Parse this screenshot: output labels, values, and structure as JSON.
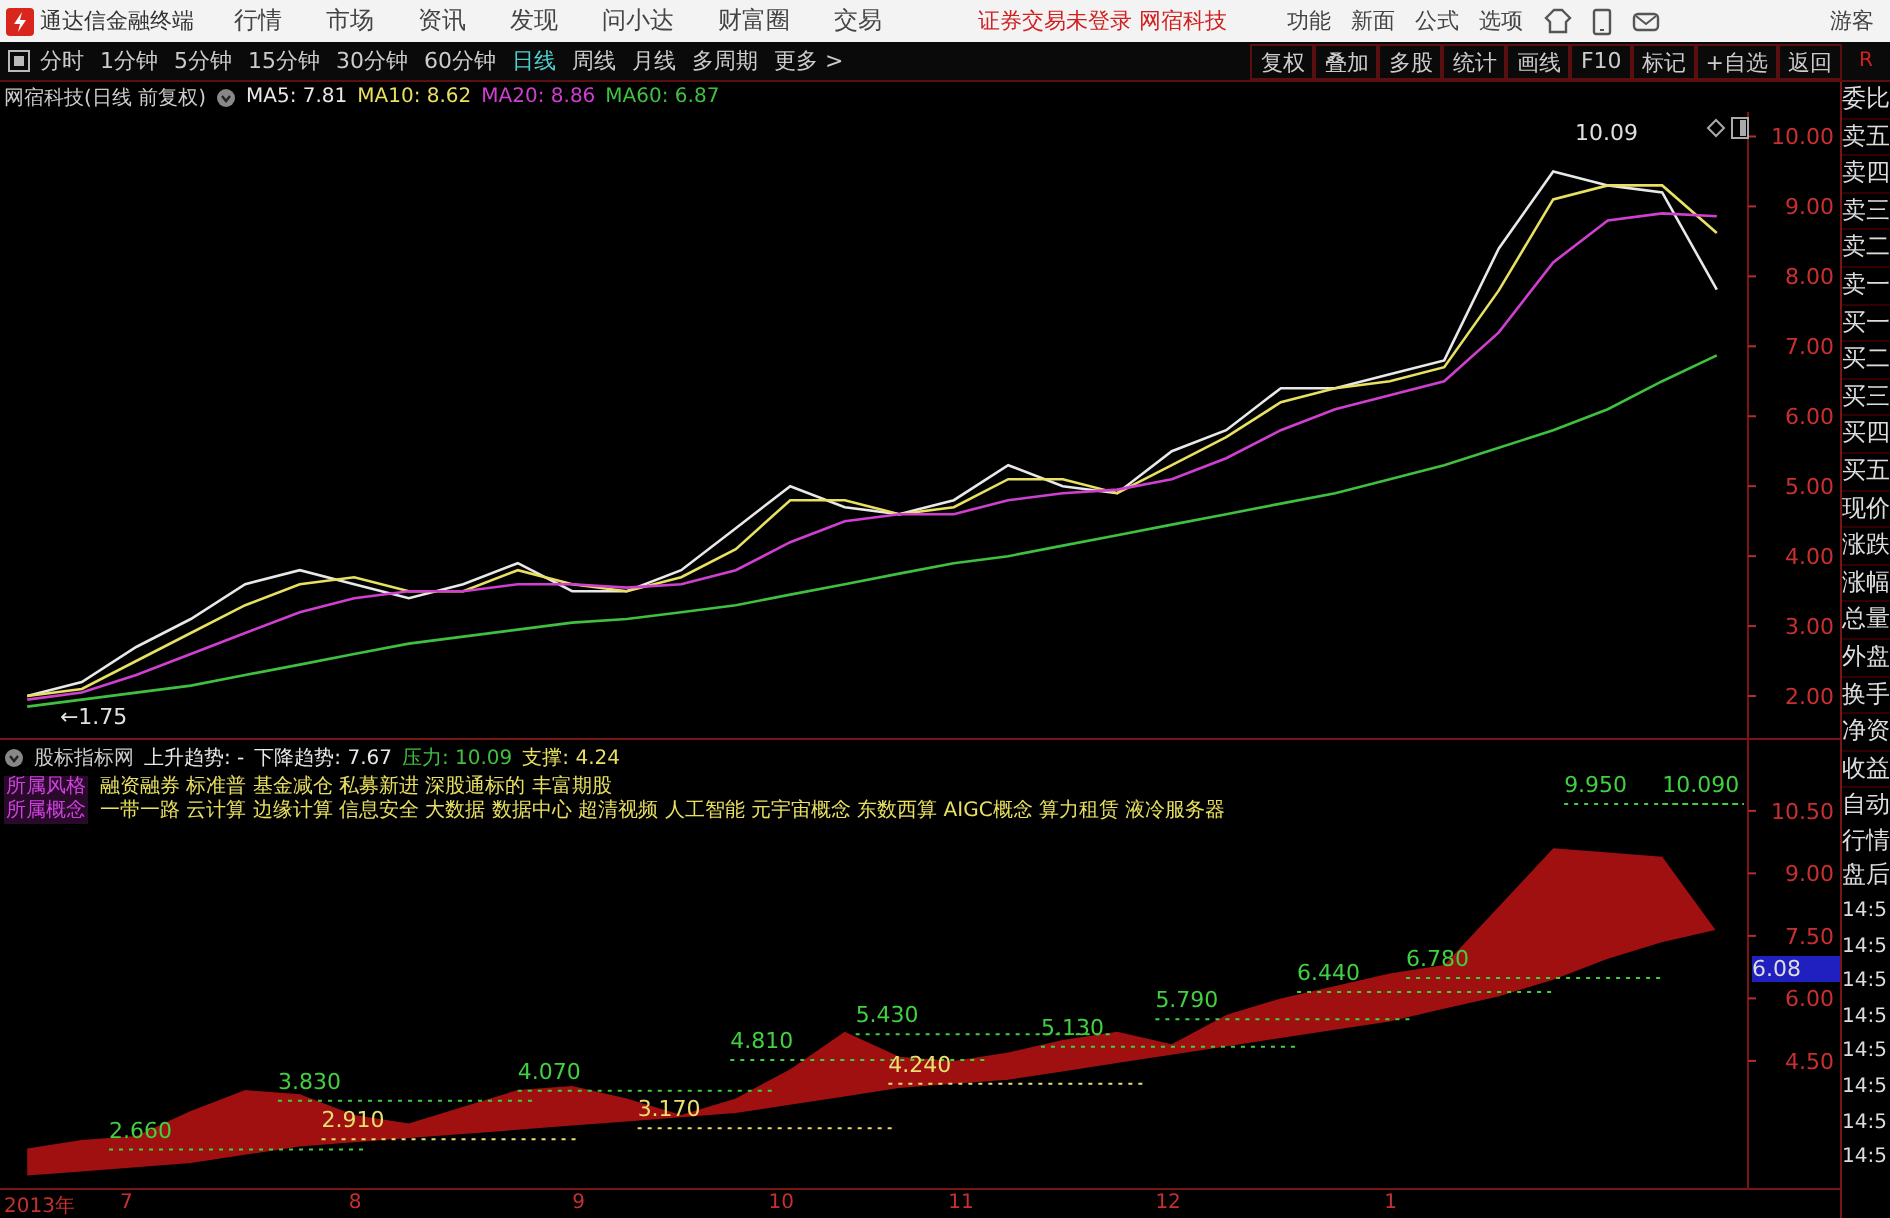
{
  "app": {
    "title": "通达信金融终端",
    "menus": [
      "行情",
      "市场",
      "资讯",
      "发现",
      "问小达",
      "财富圈",
      "交易"
    ],
    "notice": "证券交易未登录 网宿科技",
    "tools": [
      "功能",
      "新面",
      "公式",
      "选项"
    ],
    "user": "游客"
  },
  "toolbar": {
    "periods": [
      {
        "label": "分时",
        "selected": false
      },
      {
        "label": "1分钟",
        "selected": false
      },
      {
        "label": "5分钟",
        "selected": false
      },
      {
        "label": "15分钟",
        "selected": false
      },
      {
        "label": "30分钟",
        "selected": false
      },
      {
        "label": "60分钟",
        "selected": false
      },
      {
        "label": "日线",
        "selected": true
      },
      {
        "label": "周线",
        "selected": false
      },
      {
        "label": "月线",
        "selected": false
      },
      {
        "label": "多周期",
        "selected": false
      },
      {
        "label": "更多 >",
        "selected": false
      }
    ],
    "actions": [
      "复权",
      "叠加",
      "多股",
      "统计",
      "画线",
      "F10",
      "标记",
      "+自选",
      "返回"
    ],
    "corner": "R"
  },
  "price_chart": {
    "title": "网宿科技(日线 前复权)",
    "indicators": [
      {
        "label": "MA5: 7.81",
        "color": "#e8e8e8"
      },
      {
        "label": "MA10: 8.62",
        "color": "#e8e060"
      },
      {
        "label": "MA20: 8.86",
        "color": "#d040d0"
      },
      {
        "label": "MA60: 6.87",
        "color": "#40c040"
      }
    ],
    "chart_data": {
      "type": "line",
      "ylim": [
        1.4,
        10.35
      ],
      "yticks": [
        {
          "value": 2,
          "label": "2.00"
        },
        {
          "value": 3,
          "label": "3.00"
        },
        {
          "value": 4,
          "label": "4.00"
        },
        {
          "value": 5,
          "label": "5.00"
        },
        {
          "value": 6,
          "label": "6.00"
        },
        {
          "value": 7,
          "label": "7.00"
        },
        {
          "value": 8,
          "label": "8.00"
        },
        {
          "value": 9,
          "label": "9.00"
        },
        {
          "value": 10,
          "label": "10.00"
        }
      ],
      "series": [
        {
          "color": "#e8e8e8",
          "values": [
            2.0,
            2.2,
            2.7,
            3.1,
            3.6,
            3.8,
            3.6,
            3.4,
            3.6,
            3.9,
            3.5,
            3.5,
            3.8,
            4.4,
            5.0,
            4.7,
            4.6,
            4.8,
            5.3,
            5.0,
            4.9,
            5.5,
            5.8,
            6.4,
            6.4,
            6.6,
            6.8,
            8.4,
            9.5,
            9.3,
            9.2,
            7.81
          ]
        },
        {
          "color": "#e8e060",
          "values": [
            2.0,
            2.1,
            2.5,
            2.9,
            3.3,
            3.6,
            3.7,
            3.5,
            3.5,
            3.8,
            3.6,
            3.5,
            3.7,
            4.1,
            4.8,
            4.8,
            4.6,
            4.7,
            5.1,
            5.1,
            4.9,
            5.3,
            5.7,
            6.2,
            6.4,
            6.5,
            6.7,
            7.8,
            9.1,
            9.3,
            9.3,
            8.62
          ]
        },
        {
          "color": "#d040d0",
          "values": [
            1.95,
            2.05,
            2.3,
            2.6,
            2.9,
            3.2,
            3.4,
            3.5,
            3.5,
            3.6,
            3.6,
            3.55,
            3.6,
            3.8,
            4.2,
            4.5,
            4.6,
            4.6,
            4.8,
            4.9,
            4.95,
            5.1,
            5.4,
            5.8,
            6.1,
            6.3,
            6.5,
            7.2,
            8.2,
            8.8,
            8.9,
            8.86
          ]
        },
        {
          "color": "#40c040",
          "values": [
            1.85,
            1.95,
            2.05,
            2.15,
            2.3,
            2.45,
            2.6,
            2.75,
            2.85,
            2.95,
            3.05,
            3.1,
            3.2,
            3.3,
            3.45,
            3.6,
            3.75,
            3.9,
            4.0,
            4.15,
            4.3,
            4.45,
            4.6,
            4.75,
            4.9,
            5.1,
            5.3,
            5.55,
            5.8,
            6.1,
            6.5,
            6.87
          ]
        }
      ],
      "annotations": [
        "10.09",
        "←1.75"
      ]
    }
  },
  "indicator_chart": {
    "title": "股标指标网",
    "readings": [
      {
        "label": "上升趋势: -",
        "color": "#e8e8e8"
      },
      {
        "label": "下降趋势: 7.67",
        "color": "#e8e8e8"
      },
      {
        "label": "压力: 10.09",
        "color": "#40c040"
      },
      {
        "label": "支撑: 4.24",
        "color": "#e8e060"
      }
    ],
    "tags": [
      "所属风格",
      "所属概念"
    ],
    "concept_lines": [
      "融资融券 标准普 基金减仓 私募新进 深股通标的 丰富期股",
      "一带一路 云计算 边缘计算 信息安全 大数据 数据中心 超清视频 人工智能 元宇宙概念 东数西算 AIGC概念 算力租赁 液冷服务器"
    ],
    "current_value": "6.08",
    "chart_data": {
      "type": "area",
      "ylim": [
        1.45,
        12.2
      ],
      "yticks": [
        {
          "value": 4.5,
          "label": "4.50"
        },
        {
          "value": 6,
          "label": "6.00"
        },
        {
          "value": 7.5,
          "label": "7.50"
        },
        {
          "value": 9,
          "label": "9.00"
        },
        {
          "value": 10.5,
          "label": "10.50"
        }
      ],
      "series": [
        {
          "type": "area",
          "color": "#a01010",
          "values": [
            2.4,
            2.6,
            2.7,
            3.3,
            3.8,
            3.7,
            3.2,
            3.0,
            3.4,
            3.8,
            3.9,
            3.6,
            3.2,
            3.6,
            4.3,
            5.2,
            4.6,
            4.5,
            4.7,
            5.0,
            5.2,
            4.9,
            5.6,
            6.0,
            6.3,
            6.6,
            6.8,
            8.2,
            9.6,
            9.5,
            9.4,
            7.6
          ]
        },
        {
          "type": "line",
          "color": "#000000",
          "values": [
            1.7,
            1.8,
            1.9,
            2.0,
            2.2,
            2.4,
            2.5,
            2.6,
            2.7,
            2.8,
            2.9,
            3.0,
            3.1,
            3.2,
            3.4,
            3.6,
            3.8,
            3.9,
            4.0,
            4.2,
            4.4,
            4.6,
            4.8,
            5.0,
            5.2,
            5.4,
            5.7,
            6.0,
            6.4,
            6.9,
            7.3,
            7.6
          ]
        }
      ],
      "annotations": [
        "2.660",
        "3.830",
        "2.910",
        "4.070",
        "3.170",
        "4.810",
        "5.430",
        "4.240",
        "5.130",
        "5.790",
        "6.440",
        "6.780",
        "9.950",
        "10.090"
      ]
    },
    "x_axis_labels": [
      "2013年",
      "7",
      "8",
      "9",
      "10",
      "11",
      "12",
      "1"
    ]
  },
  "side_panel": {
    "labels": [
      "委比",
      "卖五",
      "卖四",
      "卖三",
      "卖二",
      "卖一",
      "买一",
      "买二",
      "买三",
      "买四",
      "买五",
      "现价",
      "涨跌",
      "涨幅",
      "总量",
      "外盘",
      "换手",
      "净资",
      "收益"
    ],
    "modes": [
      "自动",
      "行情",
      "盘后"
    ],
    "times": [
      "14:5",
      "14:5",
      "14:5",
      "14:5",
      "14:5",
      "14:5",
      "14:5",
      "14:5"
    ]
  }
}
